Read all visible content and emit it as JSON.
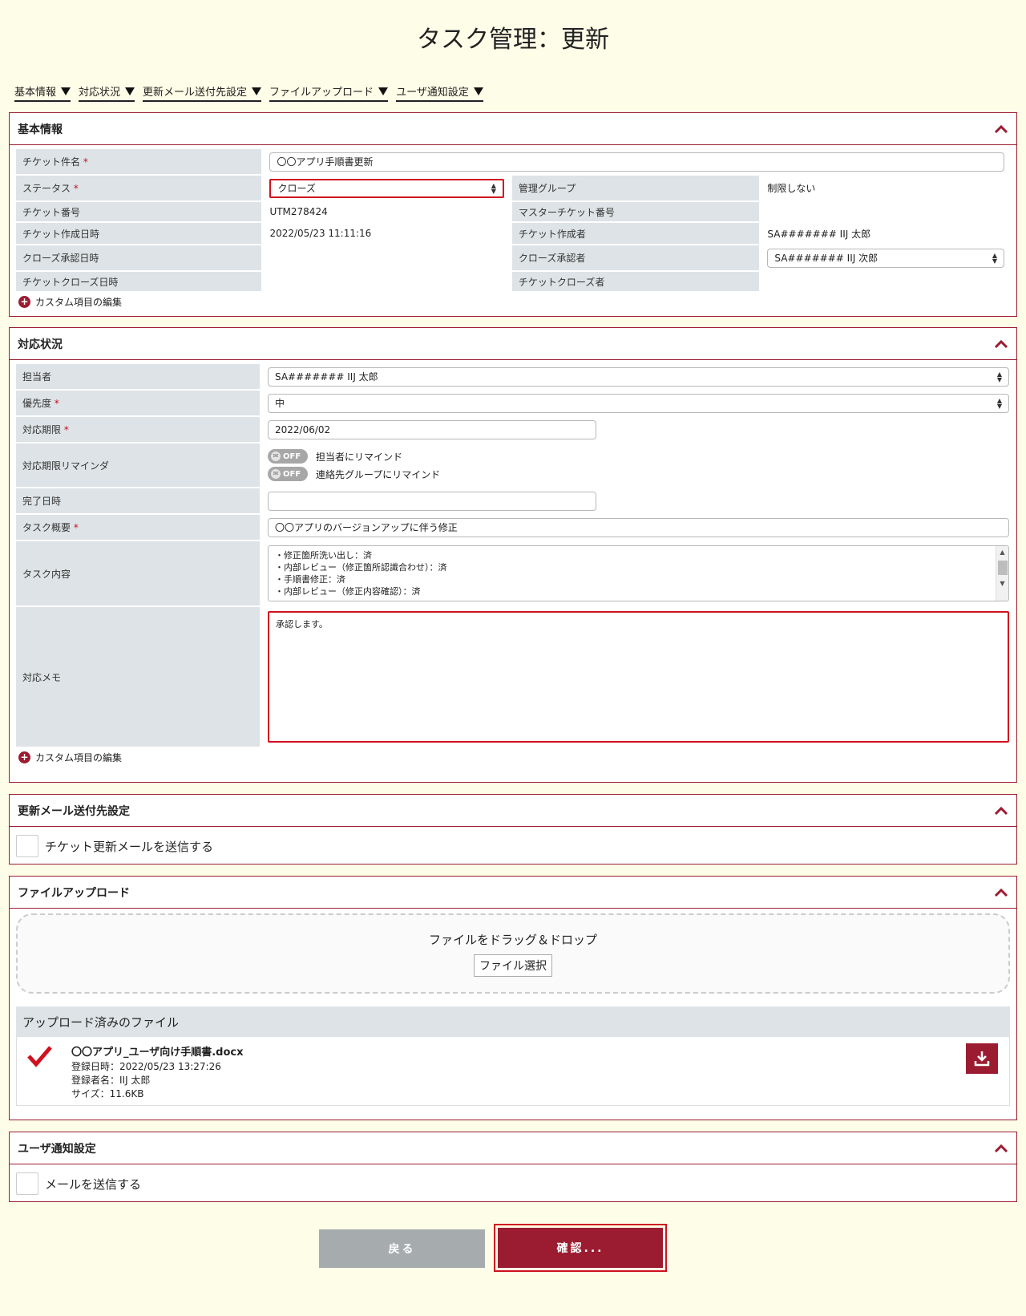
{
  "page_title": "タスク管理：更新",
  "anchors": [
    "基本情報",
    "対応状況",
    "更新メール送付先設定",
    "ファイルアップロード",
    "ユーザ通知設定"
  ],
  "basic": {
    "title": "基本情報",
    "ticket_name_label": "チケット件名",
    "ticket_name_value": "〇〇アプリ手順書更新",
    "status_label": "ステータス",
    "status_value": "クローズ",
    "mgmt_group_label": "管理グループ",
    "mgmt_group_value": "制限しない",
    "ticket_no_label": "チケット番号",
    "ticket_no_value": "UTM278424",
    "master_ticket_label": "マスターチケット番号",
    "master_ticket_value": "",
    "created_at_label": "チケット作成日時",
    "created_at_value": "2022/05/23 11:11:16",
    "creator_label": "チケット作成者",
    "creator_value": "SA####### IIJ 太郎",
    "close_approved_at_label": "クローズ承認日時",
    "close_approved_at_value": "",
    "close_approver_label": "クローズ承認者",
    "close_approver_value": "SA####### IIJ 次郎",
    "closed_at_label": "チケットクローズ日時",
    "closed_at_value": "",
    "closer_label": "チケットクローズ者",
    "closer_value": "",
    "custom_edit": "カスタム項目の編集"
  },
  "response": {
    "title": "対応状況",
    "assignee_label": "担当者",
    "assignee_value": "SA####### IIJ 太郎",
    "priority_label": "優先度",
    "priority_value": "中",
    "deadline_label": "対応期限",
    "deadline_value": "2022/06/02",
    "reminder_label": "対応期限リマインダ",
    "toggle_off": "OFF",
    "remind_assignee": "担当者にリマインド",
    "remind_group": "連絡先グループにリマインド",
    "done_label": "完了日時",
    "done_value": "",
    "summary_label": "タスク概要",
    "summary_value": "〇〇アプリのバージョンアップに伴う修正",
    "content_label": "タスク内容",
    "content_lines": [
      "・修正箇所洗い出し：済",
      "・内部レビュー（修正箇所認識合わせ）：済",
      "・手順書修正：済",
      "・内部レビュー（修正内容確認）：済"
    ],
    "memo_label": "対応メモ",
    "memo_value": "承認します。",
    "custom_edit": "カスタム項目の編集"
  },
  "mail": {
    "title": "更新メール送付先設定",
    "checkbox_label": "チケット更新メールを送信する"
  },
  "upload": {
    "title": "ファイルアップロード",
    "drop_text": "ファイルをドラッグ＆ドロップ",
    "select_button": "ファイル選択",
    "uploaded_header": "アップロード済みのファイル",
    "file_name": "〇〇アプリ_ユーザ向け手順書.docx",
    "file_date": "登録日時：2022/05/23 13:27:26",
    "file_user": "登録者名：IIJ 太郎",
    "file_size": "サイズ：11.6KB"
  },
  "notify": {
    "title": "ユーザ通知設定",
    "checkbox_label": "メールを送信する"
  },
  "buttons": {
    "back": "戻る",
    "confirm": "確認..."
  },
  "colors": {
    "accent": "#9b1c31",
    "background": "#fefde7",
    "highlight": "#d0111f"
  }
}
